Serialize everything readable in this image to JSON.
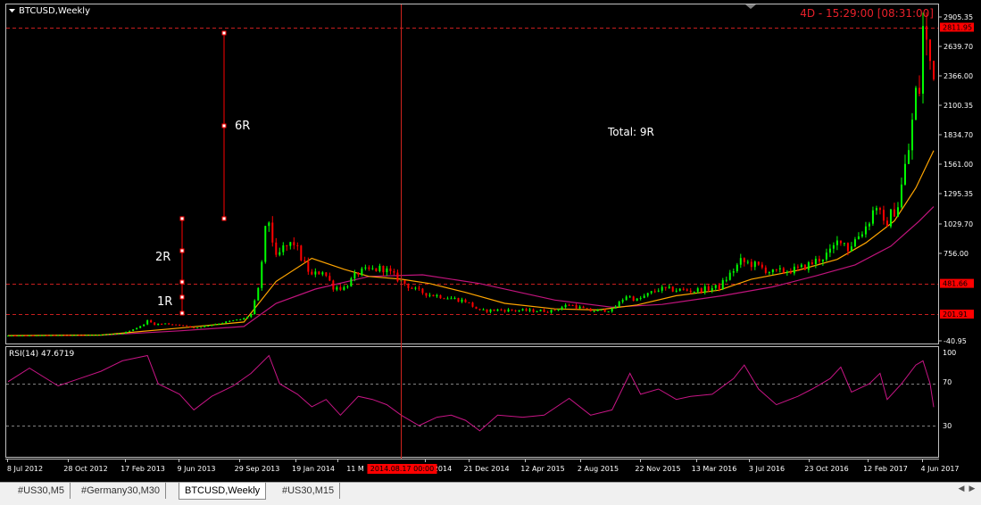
{
  "window": {
    "symbol_title": "BTCUSD,Weekly",
    "countdown": "4D - 15:29:00 [08:31:00]"
  },
  "chart_data": [
    {
      "type": "candlestick",
      "title": "BTCUSD,Weekly",
      "ylim": [
        -40.95,
        2905.35
      ],
      "price_ticks": [
        "2905.35",
        "2639.70",
        "2366.00",
        "2100.35",
        "1834.70",
        "1561.00",
        "1295.35",
        "1029.70",
        "756.00",
        "-40.95"
      ],
      "price_tags": [
        {
          "label": "2811.95",
          "value": 2811.95
        },
        {
          "label": "481.66",
          "value": 481.66
        },
        {
          "label": "201.91",
          "value": 201.91
        }
      ],
      "x_ticks": [
        "8 Jul 2012",
        "28 Oct 2012",
        "17 Feb 2013",
        "9 Jun 2013",
        "29 Sep 2013",
        "19 Jan 2014",
        "11 M",
        "2014",
        "21 Dec 2014",
        "12 Apr 2015",
        "2 Aug 2015",
        "22 Nov 2015",
        "13 Mar 2016",
        "3 Jul 2016",
        "23 Oct 2016",
        "12 Feb 2017",
        "4 Jun 2017"
      ],
      "crosshair_date": "2014.08.17 00:00",
      "annotations": {
        "r1": "1R",
        "r2": "2R",
        "r6": "6R",
        "total": "Total: 9R"
      },
      "close_path": [
        [
          "2012-07-08",
          7
        ],
        [
          "2012-10-28",
          11
        ],
        [
          "2012-12-30",
          13
        ],
        [
          "2013-02-17",
          27
        ],
        [
          "2013-03-24",
          90
        ],
        [
          "2013-04-07",
          140
        ],
        [
          "2013-04-21",
          110
        ],
        [
          "2013-05-12",
          115
        ],
        [
          "2013-06-09",
          105
        ],
        [
          "2013-07-07",
          75
        ],
        [
          "2013-08-04",
          100
        ],
        [
          "2013-09-08",
          130
        ],
        [
          "2013-10-13",
          160
        ],
        [
          "2013-10-27",
          200
        ],
        [
          "2013-11-10",
          420
        ],
        [
          "2013-11-24",
          950
        ],
        [
          "2013-12-01",
          1050
        ],
        [
          "2013-12-15",
          700
        ],
        [
          "2013-12-29",
          800
        ],
        [
          "2014-01-19",
          850
        ],
        [
          "2014-02-09",
          650
        ],
        [
          "2014-02-23",
          550
        ],
        [
          "2014-03-16",
          600
        ],
        [
          "2014-04-06",
          450
        ],
        [
          "2014-04-27",
          440
        ],
        [
          "2014-05-25",
          580
        ],
        [
          "2014-06-15",
          600
        ],
        [
          "2014-07-13",
          620
        ],
        [
          "2014-08-17",
          500
        ],
        [
          "2014-09-14",
          420
        ],
        [
          "2014-10-12",
          380
        ],
        [
          "2014-11-09",
          360
        ],
        [
          "2014-12-21",
          320
        ],
        [
          "2015-01-18",
          230
        ],
        [
          "2015-02-22",
          240
        ],
        [
          "2015-04-12",
          235
        ],
        [
          "2015-06-07",
          230
        ],
        [
          "2015-07-12",
          290
        ],
        [
          "2015-08-23",
          230
        ],
        [
          "2015-10-04",
          240
        ],
        [
          "2015-11-01",
          370
        ],
        [
          "2015-11-22",
          330
        ],
        [
          "2016-01-03",
          430
        ],
        [
          "2016-02-21",
          420
        ],
        [
          "2016-03-13",
          415
        ],
        [
          "2016-05-01",
          450
        ],
        [
          "2016-06-12",
          680
        ],
        [
          "2016-07-03",
          660
        ],
        [
          "2016-08-14",
          580
        ],
        [
          "2016-10-02",
          610
        ],
        [
          "2016-10-23",
          650
        ],
        [
          "2016-12-04",
          760
        ],
        [
          "2016-12-25",
          900
        ],
        [
          "2017-01-08",
          800
        ],
        [
          "2017-02-12",
          1000
        ],
        [
          "2017-03-05",
          1200
        ],
        [
          "2017-03-19",
          1000
        ],
        [
          "2017-04-16",
          1200
        ],
        [
          "2017-05-07",
          1700
        ],
        [
          "2017-05-21",
          2200
        ],
        [
          "2017-05-28",
          2250
        ],
        [
          "2017-06-04",
          2800
        ],
        [
          "2017-06-11",
          2650
        ],
        [
          "2017-06-18",
          2500
        ],
        [
          "2017-06-25",
          2450
        ]
      ],
      "ma_fast": [
        [
          "2012-07-08",
          7
        ],
        [
          "2013-01-06",
          12
        ],
        [
          "2013-06-09",
          75
        ],
        [
          "2013-10-13",
          130
        ],
        [
          "2013-12-15",
          500
        ],
        [
          "2014-02-23",
          710
        ],
        [
          "2014-04-27",
          610
        ],
        [
          "2014-06-15",
          545
        ],
        [
          "2014-08-17",
          520
        ],
        [
          "2014-10-12",
          480
        ],
        [
          "2014-12-21",
          400
        ],
        [
          "2015-03-08",
          300
        ],
        [
          "2015-06-14",
          250
        ],
        [
          "2015-09-06",
          240
        ],
        [
          "2015-11-22",
          285
        ],
        [
          "2016-02-07",
          370
        ],
        [
          "2016-05-01",
          420
        ],
        [
          "2016-07-03",
          520
        ],
        [
          "2016-10-02",
          600
        ],
        [
          "2016-12-18",
          700
        ],
        [
          "2017-02-12",
          850
        ],
        [
          "2017-04-09",
          1050
        ],
        [
          "2017-05-21",
          1350
        ],
        [
          "2017-06-25",
          1690
        ]
      ],
      "ma_slow": [
        [
          "2012-07-08",
          6
        ],
        [
          "2013-01-06",
          10
        ],
        [
          "2013-06-09",
          50
        ],
        [
          "2013-10-13",
          90
        ],
        [
          "2013-12-15",
          300
        ],
        [
          "2014-03-02",
          430
        ],
        [
          "2014-06-15",
          545
        ],
        [
          "2014-09-28",
          560
        ],
        [
          "2015-01-18",
          480
        ],
        [
          "2015-06-14",
          330
        ],
        [
          "2015-10-04",
          265
        ],
        [
          "2016-01-10",
          290
        ],
        [
          "2016-05-08",
          370
        ],
        [
          "2016-08-14",
          450
        ],
        [
          "2016-11-06",
          550
        ],
        [
          "2017-01-22",
          650
        ],
        [
          "2017-04-02",
          820
        ],
        [
          "2017-05-28",
          1050
        ],
        [
          "2017-06-25",
          1180
        ]
      ]
    },
    {
      "type": "line",
      "title": "RSI(14) 47.6719",
      "ylim": [
        8,
        105
      ],
      "y_ticks": [
        "100",
        "70",
        "30"
      ],
      "levels": [
        70,
        30
      ],
      "rsi": [
        [
          "2012-07-08",
          72
        ],
        [
          "2012-08-19",
          85
        ],
        [
          "2012-10-14",
          68
        ],
        [
          "2012-11-25",
          75
        ],
        [
          "2013-01-06",
          82
        ],
        [
          "2013-02-17",
          92
        ],
        [
          "2013-04-07",
          97
        ],
        [
          "2013-04-28",
          70
        ],
        [
          "2013-06-09",
          60
        ],
        [
          "2013-07-07",
          45
        ],
        [
          "2013-08-11",
          58
        ],
        [
          "2013-09-22",
          68
        ],
        [
          "2013-10-27",
          80
        ],
        [
          "2013-12-01",
          97
        ],
        [
          "2013-12-22",
          70
        ],
        [
          "2014-01-26",
          60
        ],
        [
          "2014-02-23",
          48
        ],
        [
          "2014-03-23",
          55
        ],
        [
          "2014-04-20",
          40
        ],
        [
          "2014-05-25",
          58
        ],
        [
          "2014-06-22",
          55
        ],
        [
          "2014-07-20",
          50
        ],
        [
          "2014-08-17",
          40
        ],
        [
          "2014-09-21",
          30
        ],
        [
          "2014-10-26",
          38
        ],
        [
          "2014-11-23",
          40
        ],
        [
          "2014-12-21",
          35
        ],
        [
          "2015-01-18",
          25
        ],
        [
          "2015-02-22",
          40
        ],
        [
          "2015-04-12",
          38
        ],
        [
          "2015-05-24",
          40
        ],
        [
          "2015-07-12",
          56
        ],
        [
          "2015-08-23",
          40
        ],
        [
          "2015-10-04",
          45
        ],
        [
          "2015-11-08",
          80
        ],
        [
          "2015-11-29",
          60
        ],
        [
          "2016-01-03",
          65
        ],
        [
          "2016-02-07",
          55
        ],
        [
          "2016-03-06",
          58
        ],
        [
          "2016-04-17",
          60
        ],
        [
          "2016-05-29",
          75
        ],
        [
          "2016-06-19",
          88
        ],
        [
          "2016-07-17",
          65
        ],
        [
          "2016-08-21",
          50
        ],
        [
          "2016-10-02",
          58
        ],
        [
          "2016-10-30",
          65
        ],
        [
          "2016-12-04",
          75
        ],
        [
          "2016-12-25",
          86
        ],
        [
          "2017-01-15",
          62
        ],
        [
          "2017-02-19",
          70
        ],
        [
          "2017-03-12",
          80
        ],
        [
          "2017-03-26",
          55
        ],
        [
          "2017-04-23",
          70
        ],
        [
          "2017-05-21",
          88
        ],
        [
          "2017-06-04",
          92
        ],
        [
          "2017-06-18",
          70
        ],
        [
          "2017-06-25",
          47.67
        ]
      ]
    }
  ],
  "tabs": [
    {
      "label": "#US30,M5",
      "active": false
    },
    {
      "label": "#Germany30,M30",
      "active": false
    },
    {
      "label": "BTCUSD,Weekly",
      "active": true
    },
    {
      "label": "#US30,M15",
      "active": false
    }
  ],
  "colors": {
    "background": "#000000",
    "frame": "#c0c0c0",
    "bull": "#00ff00",
    "bear": "#ff0000",
    "ma_fast": "#ffa500",
    "ma_slow": "#c0147c",
    "rsi": "#c71585",
    "level_line": "#c81e1e",
    "crosshair": "#d0241e",
    "countdown": "#e8202a",
    "text": "#ffffff"
  }
}
